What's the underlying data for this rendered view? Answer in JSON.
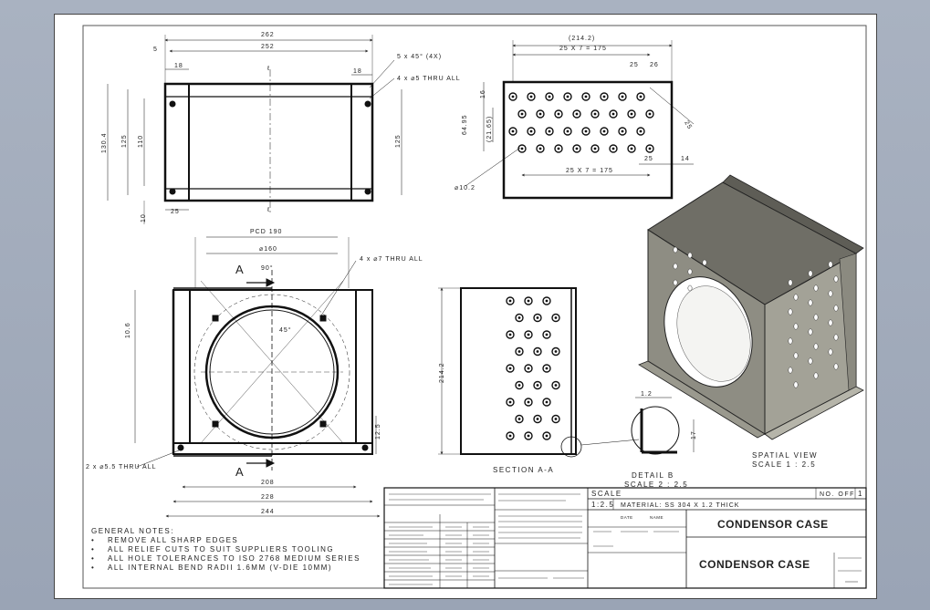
{
  "top_view": {
    "dims": {
      "overall_width": "262",
      "inner_width": "252",
      "left_inset": "5",
      "flange_left": "18",
      "flange_right": "18",
      "height_outer": "130.4",
      "height_mid": "125",
      "height_inner": "110",
      "height_right": "125",
      "base_offset": "10",
      "hole_offset": "25"
    },
    "callouts": {
      "chamfer": "5 x 45° (4X)",
      "holes": "4 x ⌀5 THRU ALL"
    },
    "centerline_marks": [
      "ℓ",
      "ℓ"
    ]
  },
  "side_view": {
    "dims": {
      "overall": "(214.2)",
      "pattern_top": "25 X 7 = 175",
      "pitch_a": "25",
      "pitch_b": "26",
      "left_offset": "16",
      "vert_a": "64.95",
      "vert_b": "(21.65)",
      "diag_pitch": "25",
      "bottom_a": "25",
      "bottom_b": "14",
      "pattern_bottom": "25 X 7 = 175",
      "hole_dia": "⌀10.2"
    }
  },
  "front_view": {
    "dims": {
      "pcd": "PCD 190",
      "bore": "⌀160",
      "angle_top": "90°",
      "angle_mid": "45°",
      "height": "10.6",
      "foot": "12.5",
      "w1": "208",
      "w2": "228",
      "w3": "244"
    },
    "callouts": {
      "holes": "4 x ⌀7 THRU ALL",
      "base_holes": "2 x ⌀5.5 THRU ALL"
    },
    "section_label": "A"
  },
  "section_view": {
    "dims": {
      "height": "214.2"
    },
    "caption": "SECTION A-A"
  },
  "detail_b": {
    "dims": {
      "thick": "1.2",
      "flange": "17"
    },
    "caption_1": "DETAIL B",
    "caption_2": "SCALE 2 : 2.5"
  },
  "spatial_view": {
    "caption_1": "SPATIAL VIEW",
    "caption_2": "SCALE 1 : 2.5"
  },
  "general_notes": {
    "heading": "GENERAL NOTES:",
    "items": [
      "REMOVE ALL SHARP EDGES",
      "ALL RELIEF CUTS TO SUIT SUPPLIERS TOOLING",
      "ALL HOLE TOLERANCES TO ISO 2768 MEDIUM SERIES",
      "ALL INTERNAL BEND RADII 1.6MM (V-DIE 10MM)"
    ]
  },
  "title_block": {
    "scale_label": "SCALE",
    "scale_value": "1:2.5",
    "material": "MATERIAL: SS 304 X 1.2 THICK",
    "no_off_label": "NO. OFF",
    "no_off_value": "1",
    "title_1": "CONDENSOR CASE",
    "title_2": "CONDENSOR CASE",
    "date_label": "DATE",
    "name_label": "NAME"
  },
  "colors": {
    "background": "#9aa4b5",
    "sheet": "#ffffff",
    "line": "#111111",
    "model_body": "#8b8a80",
    "model_dark": "#6e6d64"
  }
}
